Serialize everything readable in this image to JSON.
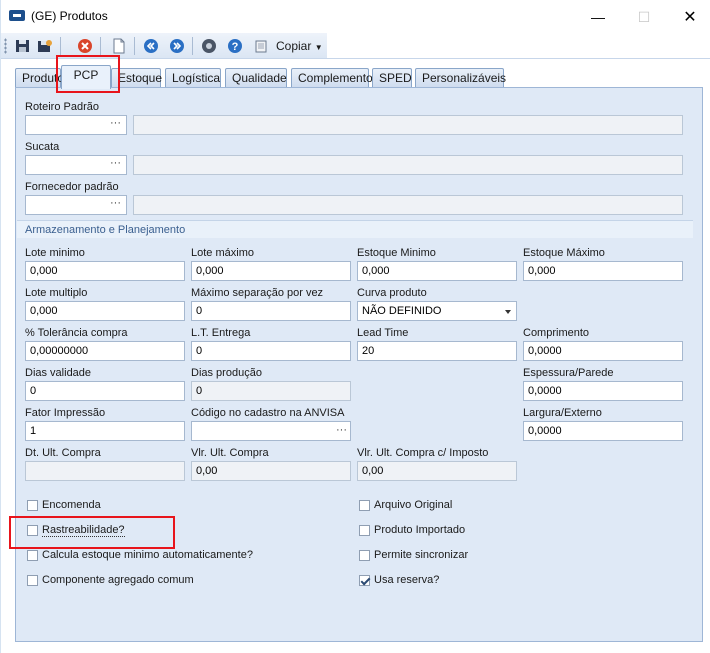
{
  "window": {
    "title": "(GE) Produtos",
    "min": "—",
    "max": "☐",
    "close": "✕"
  },
  "toolbar": {
    "copy_label": "Copiar"
  },
  "tabs": [
    "Produto",
    "PCP",
    "Estoque",
    "Logística",
    "Qualidade",
    "Complemento",
    "SPED",
    "Personalizáveis"
  ],
  "active_tab": "PCP",
  "top_fields": {
    "roteiro": {
      "label": "Roteiro Padrão",
      "value": "",
      "desc": ""
    },
    "sucata": {
      "label": "Sucata",
      "value": "",
      "desc": ""
    },
    "fornecedor": {
      "label": "Fornecedor padrão",
      "value": "",
      "desc": ""
    },
    "lookup_glyph": "···"
  },
  "section": {
    "title": "Armazenamento e Planejamento"
  },
  "fields": {
    "lote_minimo": {
      "label": "Lote minimo",
      "value": "0,000"
    },
    "lote_maximo": {
      "label": "Lote máximo",
      "value": "0,000"
    },
    "estoque_minimo": {
      "label": "Estoque Minimo",
      "value": "0,000"
    },
    "estoque_maximo": {
      "label": "Estoque Máximo",
      "value": "0,000"
    },
    "lote_multiplo": {
      "label": "Lote multiplo",
      "value": "0,000"
    },
    "max_separacao": {
      "label": "Máximo separação por vez",
      "value": "0"
    },
    "curva_produto": {
      "label": "Curva produto",
      "value": "NÃO DEFINIDO"
    },
    "tolerancia_compra": {
      "label": "% Tolerância compra",
      "value": "0,00000000"
    },
    "lt_entrega": {
      "label": "L.T. Entrega",
      "value": "0"
    },
    "lead_time": {
      "label": "Lead Time",
      "value": "20"
    },
    "comprimento": {
      "label": "Comprimento",
      "value": "0,0000"
    },
    "dias_validade": {
      "label": "Dias validade",
      "value": "0"
    },
    "dias_producao": {
      "label": "Dias produção",
      "value": "0"
    },
    "espessura": {
      "label": "Espessura/Parede",
      "value": "0,0000"
    },
    "fator_impressao": {
      "label": "Fator Impressão",
      "value": "1"
    },
    "codigo_anvisa": {
      "label": "Código no cadastro na ANVISA",
      "value": ""
    },
    "largura": {
      "label": "Largura/Externo",
      "value": "0,0000"
    },
    "dt_ult_compra": {
      "label": "Dt. Ult. Compra",
      "value": ""
    },
    "vlr_ult_compra": {
      "label": "Vlr. Ult. Compra",
      "value": "0,00"
    },
    "vlr_ult_compra_imposto": {
      "label": "Vlr. Ult. Compra c/ Imposto",
      "value": "0,00"
    }
  },
  "checkboxes": {
    "encomenda": {
      "label": "Encomenda",
      "checked": false
    },
    "rastreabilidade": {
      "label": "Rastreabilidade?",
      "checked": false
    },
    "calcula_estoque": {
      "label": "Calcula estoque minimo automaticamente?",
      "checked": false
    },
    "componente_agregado": {
      "label": "Componente agregado comum",
      "checked": false
    },
    "arquivo_original": {
      "label": "Arquivo Original",
      "checked": false
    },
    "produto_importado": {
      "label": "Produto Importado",
      "checked": false
    },
    "permite_sincronizar": {
      "label": "Permite sincronizar",
      "checked": false
    },
    "usa_reserva": {
      "label": "Usa reserva?",
      "checked": true
    }
  },
  "colors": {
    "highlight": "#e8141b",
    "panel": "#dfe9f6",
    "accent": "#3a5f8f"
  }
}
